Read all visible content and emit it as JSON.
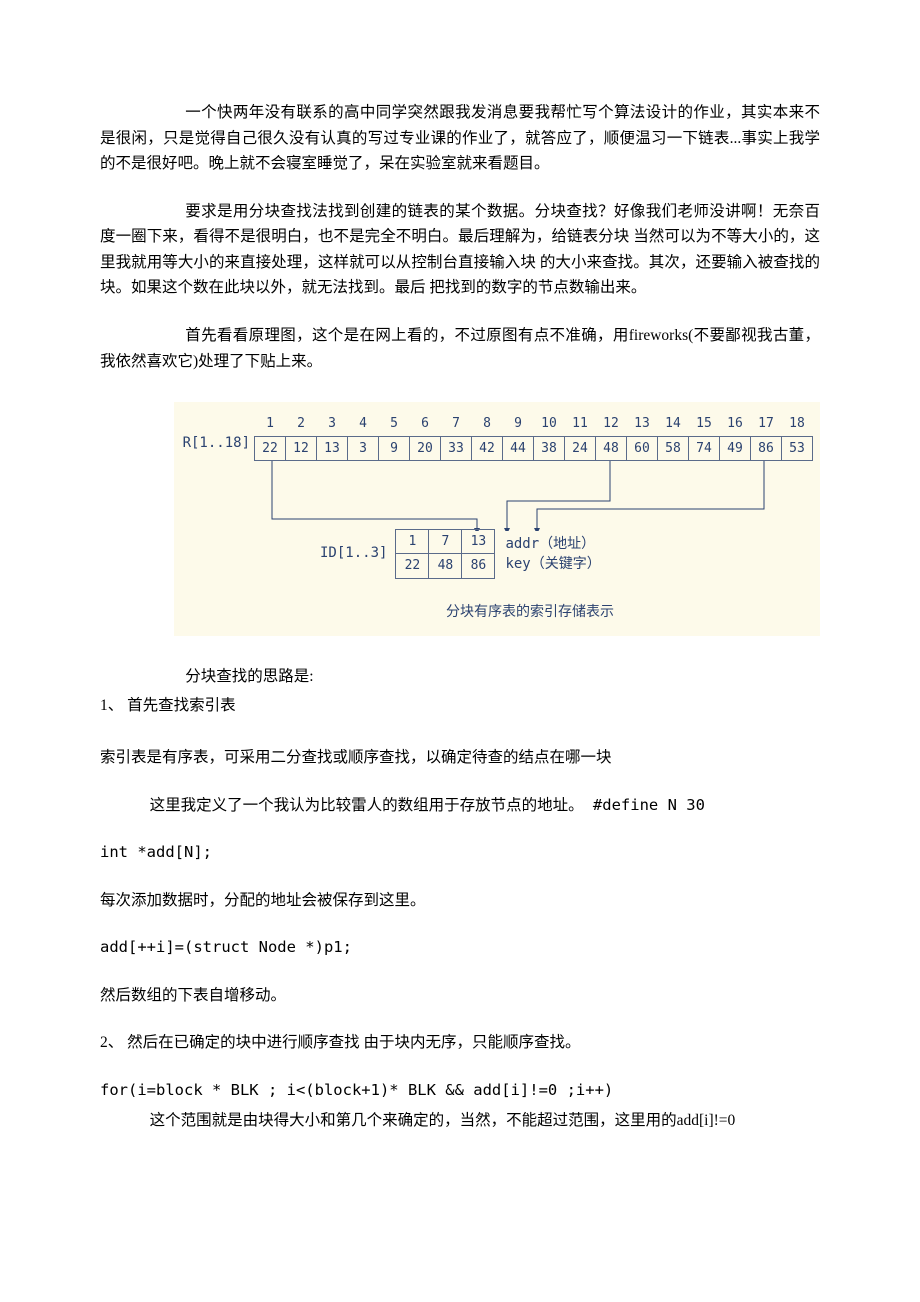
{
  "para1": "一个快两年没有联系的高中同学突然跟我发消息要我帮忙写个算法设计的作业，其实本来不是很闲，只是觉得自己很久没有认真的写过专业课的作业了，就答应了，顺便温习一下链表...事实上我学的不是很好吧。晚上就不会寝室睡觉了，呆在实验室就来看题目。",
  "para2": "要求是用分块查找法找到创建的链表的某个数据。分块查找？好像我们老师没讲啊！无奈百度一圈下来，看得不是很明白，也不是完全不明白。最后理解为，给链表分块 当然可以为不等大小的，这里我就用等大小的来直接处理，这样就可以从控制台直接输入块 的大小来查找。其次，还要输入被查找的块。如果这个数在此块以外，就无法找到。最后 把找到的数字的节点数输出来。",
  "para3": "首先看看原理图，这个是在网上看的，不过原图有点不准确，用fireworks(不要鄙视我古董，我依然喜欢它)处理了下贴上来。",
  "figure": {
    "r_label": "R[1..18]",
    "indices": [
      "1",
      "2",
      "3",
      "4",
      "5",
      "6",
      "7",
      "8",
      "9",
      "10",
      "11",
      "12",
      "13",
      "14",
      "15",
      "16",
      "17",
      "18"
    ],
    "values": [
      "22",
      "12",
      "13",
      "3",
      "9",
      "20",
      "33",
      "42",
      "44",
      "38",
      "24",
      "48",
      "60",
      "58",
      "74",
      "49",
      "86",
      "53"
    ],
    "id_label": "ID[1..3]",
    "id_addr": [
      "1",
      "7",
      "13"
    ],
    "id_key": [
      "22",
      "48",
      "86"
    ],
    "addr_text": "addr（地址）",
    "key_text": "key（关键字）",
    "caption": "分块有序表的索引存储表示"
  },
  "para4": "分块查找的思路是:",
  "li1": "1、 首先查找索引表",
  "para5": "索引表是有序表，可采用二分查找或顺序查找，以确定待查的结点在哪一块",
  "para6": "这里我定义了一个我认为比较雷人的数组用于存放节点的地址。 #define N 30",
  "code1": "int *add[N];",
  "para7": "每次添加数据时，分配的地址会被保存到这里。",
  "code2": "add[++i]=(struct Node *)p1;",
  "para8": "然后数组的下表自增移动。",
  "li2": "2、 然后在已确定的块中进行顺序查找 由于块内无序，只能顺序查找。",
  "code3": "for(i=block * BLK ; i<(block+1)* BLK && add[i]!=0 ;i++)",
  "para9": "这个范围就是由块得大小和第几个来确定的，当然，不能超过范围，这里用的add[i]!=0",
  "chart_data": {
    "type": "table",
    "title": "分块有序表的索引存储表示",
    "R_indices": [
      1,
      2,
      3,
      4,
      5,
      6,
      7,
      8,
      9,
      10,
      11,
      12,
      13,
      14,
      15,
      16,
      17,
      18
    ],
    "R_values": [
      22,
      12,
      13,
      3,
      9,
      20,
      33,
      42,
      44,
      38,
      24,
      48,
      60,
      58,
      74,
      49,
      86,
      53
    ],
    "ID_addr": [
      1,
      7,
      13
    ],
    "ID_key": [
      22,
      48,
      86
    ],
    "pointer_source_R_index": [
      1,
      12,
      17
    ],
    "pointer_target_ID_index": [
      1,
      2,
      3
    ],
    "annotations": [
      "addr（地址）",
      "key（关键字）"
    ]
  }
}
